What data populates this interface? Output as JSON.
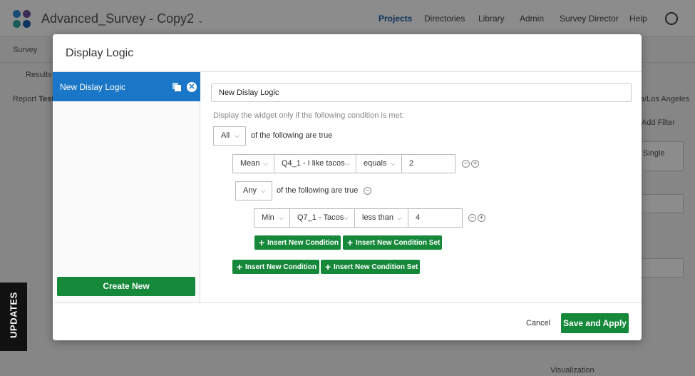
{
  "app": {
    "title": "Advanced_Survey - Copy2",
    "nav": [
      "Projects",
      "Directories",
      "Library",
      "Admin",
      "Survey Director",
      "Help"
    ]
  },
  "background": {
    "tab_survey": "Survey",
    "results": "Results",
    "report_label": "Report",
    "report_name_partial": "Test",
    "timezone": "a/Los Angeles",
    "add_filter": "Add Filter",
    "single": "Single",
    "visualization": "Visualization"
  },
  "updates_label": "UPDATES",
  "modal": {
    "title": "Display Logic",
    "sidebar": {
      "items": [
        {
          "label": "New Dislay Logic"
        }
      ],
      "create_new": "Create New"
    },
    "name_value": "New Dislay Logic",
    "hint": "Display the widget only if the following condition is met:",
    "root": {
      "quantifier": "All",
      "suffix": "of the following are true",
      "condition": {
        "agg": "Mean",
        "field": "Q4_1 - I like tacos",
        "op": "equals",
        "value": "2"
      },
      "nested": {
        "quantifier": "Any",
        "suffix": "of the following are true",
        "condition": {
          "agg": "Min",
          "field": "Q7_1 - Tacos",
          "op": "less than",
          "value": "4"
        }
      }
    },
    "insert_condition": "Insert New Condition",
    "insert_condition_set": "Insert New Condition Set",
    "footer": {
      "cancel": "Cancel",
      "save": "Save and Apply"
    }
  },
  "colors": {
    "primary_blue": "#1a76c6",
    "green": "#16883a",
    "nav_active": "#1a5ea8"
  }
}
